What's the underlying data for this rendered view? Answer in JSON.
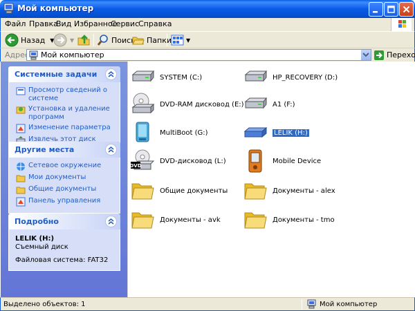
{
  "window": {
    "title": "Мой компьютер"
  },
  "menu": {
    "items": [
      "Файл",
      "Правка",
      "Вид",
      "Избранное",
      "Сервис",
      "Справка"
    ]
  },
  "toolbar": {
    "back": "Назад",
    "search": "Поиск",
    "folders": "Папки"
  },
  "address": {
    "label": "Адрес:",
    "value": "Мой компьютер",
    "go": "Переход"
  },
  "left_panel": {
    "system_tasks": {
      "title": "Системные задачи",
      "items": [
        "Просмотр сведений о системе",
        "Установка и удаление программ",
        "Изменение параметра",
        "Извлечь этот диск"
      ]
    },
    "other_places": {
      "title": "Другие места",
      "items": [
        "Сетевое окружение",
        "Мои документы",
        "Общие документы",
        "Панель управления"
      ]
    },
    "details": {
      "title": "Подробно",
      "name": "LELIK (H:)",
      "type": "Съемный диск",
      "fs": "Файловая система: FAT32"
    }
  },
  "drives": [
    {
      "name": "SYSTEM (C:)",
      "icon": "hard-drive-icon"
    },
    {
      "name": "HP_RECOVERY (D:)",
      "icon": "hard-drive-icon"
    },
    {
      "name": "DVD-RAM дисковод (E:)",
      "icon": "dvd-ram-drive-icon"
    },
    {
      "name": "A1 (F:)",
      "icon": "hard-drive-icon"
    },
    {
      "name": "MultiBoot (G:)",
      "icon": "multiboot-drive-icon"
    },
    {
      "name": "LELIK (H:)",
      "icon": "removable-drive-icon",
      "selected": true
    },
    {
      "name": "DVD-дисковод (L:)",
      "icon": "dvd-drive-icon"
    },
    {
      "name": "Mobile Device",
      "icon": "mobile-device-icon"
    },
    {
      "name": "Общие документы",
      "icon": "folder-icon"
    },
    {
      "name": "Документы - alex",
      "icon": "folder-icon"
    },
    {
      "name": "Документы - avk",
      "icon": "folder-icon"
    },
    {
      "name": "Документы - tmo",
      "icon": "folder-icon"
    }
  ],
  "status": {
    "left": "Выделено объектов: 1",
    "right": "Мой компьютер"
  },
  "colors": {
    "title_blue": "#0a5be5",
    "panel_blue": "#215dc6",
    "selection": "#316ac5"
  }
}
